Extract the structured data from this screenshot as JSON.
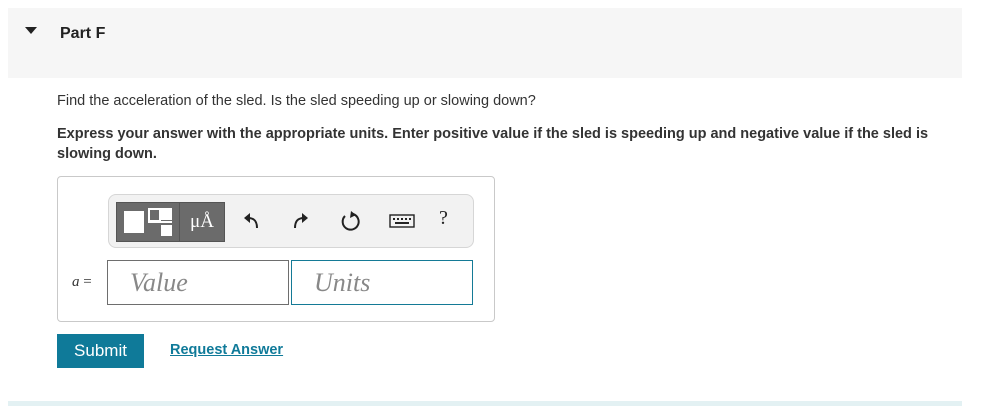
{
  "part": {
    "title": "Part F"
  },
  "question": "Find the acceleration of the sled. Is the sled speeding up or slowing down?",
  "instruction": "Express your answer with the appropriate units. Enter positive value if the sled is speeding up and negative value if the sled is slowing down.",
  "toolbar": {
    "units_label": "μÅ",
    "help_label": "?"
  },
  "answer": {
    "variable": "a",
    "equals": "=",
    "value_placeholder": "Value",
    "units_placeholder": "Units"
  },
  "actions": {
    "submit_label": "Submit",
    "request_label": "Request Answer"
  },
  "colors": {
    "accent": "#0f7a99",
    "header_bg": "#f6f6f6"
  }
}
